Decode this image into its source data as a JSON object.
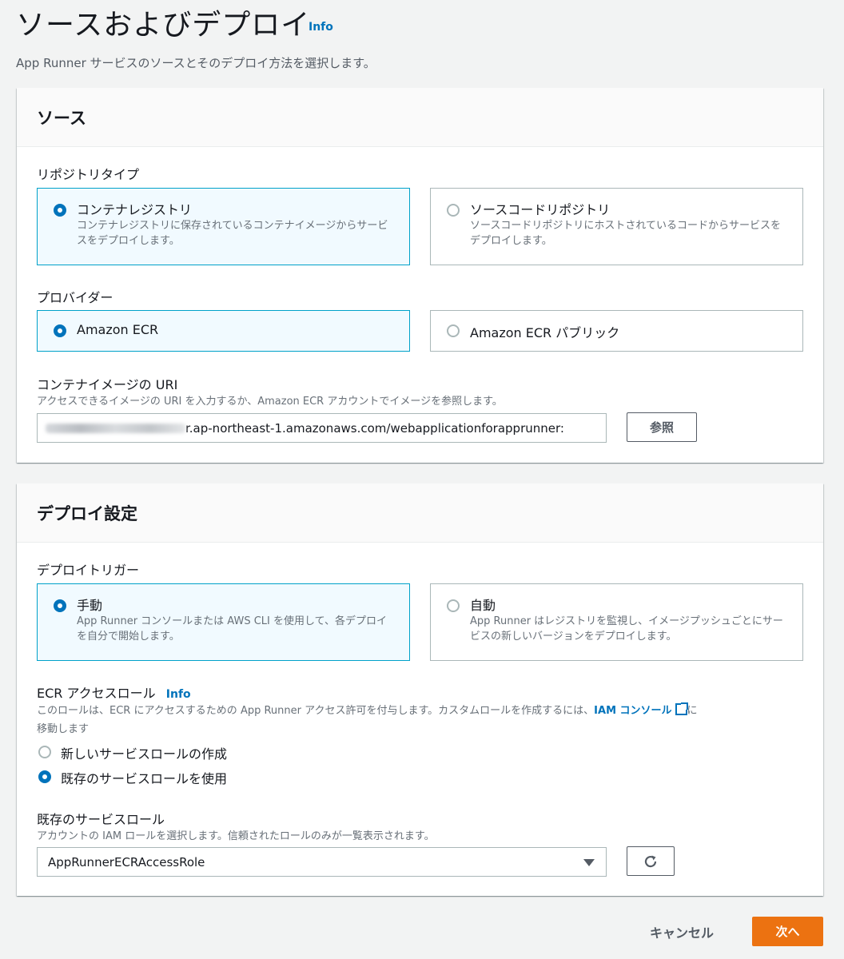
{
  "page": {
    "title": "ソースおよびデプロイ",
    "info": "Info",
    "description": "App Runner サービスのソースとそのデプロイ方法を選択します。"
  },
  "source": {
    "heading": "ソース",
    "repo_type_label": "リポジトリタイプ",
    "repo_options": [
      {
        "title": "コンテナレジストリ",
        "desc": "コンテナレジストリに保存されているコンテナイメージからサービスをデプロイします。",
        "selected": true
      },
      {
        "title": "ソースコードリポジトリ",
        "desc": "ソースコードリポジトリにホストされているコードからサービスをデプロイします。",
        "selected": false
      }
    ],
    "provider_label": "プロバイダー",
    "provider_options": [
      {
        "title": "Amazon ECR",
        "selected": true
      },
      {
        "title": "Amazon ECR パブリック",
        "selected": false
      }
    ],
    "uri_label": "コンテナイメージの URI",
    "uri_desc": "アクセスできるイメージの URI を入力するか、Amazon ECR アカウントでイメージを参照します。",
    "uri_value_visible": "r.ap-northeast-1.amazonaws.com/webapplicationforapprunner:",
    "browse_button": "参照"
  },
  "deploy": {
    "heading": "デプロイ設定",
    "trigger_label": "デプロイトリガー",
    "trigger_options": [
      {
        "title": "手動",
        "desc": "App Runner コンソールまたは AWS CLI を使用して、各デプロイを自分で開始します。",
        "selected": true
      },
      {
        "title": "自動",
        "desc": "App Runner はレジストリを監視し、イメージプッシュごとにサービスの新しいバージョンをデプロイします。",
        "selected": false
      }
    ],
    "ecr_role_label": "ECR アクセスロール",
    "ecr_role_info": "Info",
    "ecr_role_desc_before": "このロールは、ECR にアクセスするための App Runner アクセス許可を付与します。カスタムロールを作成するには、",
    "iam_console_link": "IAM コンソール",
    "ecr_role_desc_after_line1": "に",
    "ecr_role_desc_line2": "移動します",
    "role_radio_options": [
      {
        "label": "新しいサービスロールの作成",
        "selected": false
      },
      {
        "label": "既存のサービスロールを使用",
        "selected": true
      }
    ],
    "existing_role_label": "既存のサービスロール",
    "existing_role_desc": "アカウントの IAM ロールを選択します。信頼されたロールのみが一覧表示されます。",
    "existing_role_value": "AppRunnerECRAccessRole"
  },
  "footer": {
    "cancel": "キャンセル",
    "next": "次へ"
  },
  "colors": {
    "accent": "#0073bb",
    "primary_button": "#ec7211",
    "selected_tile_bg": "#f1faff",
    "selected_tile_border": "#00a1c9"
  }
}
